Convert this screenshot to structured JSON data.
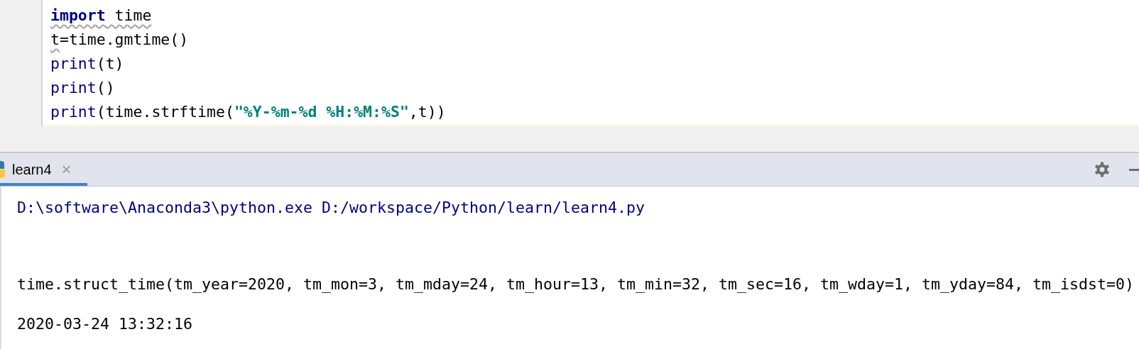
{
  "editor": {
    "lines": [
      {
        "tokens": [
          {
            "kind": "keyword",
            "text": "import",
            "warning": true
          },
          {
            "kind": "plain",
            "text": " time",
            "warning": true
          }
        ]
      },
      {
        "tokens": [
          {
            "kind": "plain",
            "text": "t",
            "warning": true
          },
          {
            "kind": "plain",
            "text": "=time.gmtime()",
            "warning": false
          }
        ]
      },
      {
        "tokens": [
          {
            "kind": "builtin",
            "text": "print",
            "warning": false
          },
          {
            "kind": "plain",
            "text": "(t)",
            "warning": false
          }
        ]
      },
      {
        "tokens": [
          {
            "kind": "builtin",
            "text": "print",
            "warning": false
          },
          {
            "kind": "plain",
            "text": "()",
            "warning": false
          }
        ]
      },
      {
        "tokens": [
          {
            "kind": "builtin",
            "text": "print",
            "warning": false
          },
          {
            "kind": "plain",
            "text": "(time.strftime(",
            "warning": false
          },
          {
            "kind": "string",
            "text": "\"%Y-%m-%d %H:%M:%S\"",
            "warning": false
          },
          {
            "kind": "plain",
            "text": ",t))",
            "warning": false
          }
        ]
      }
    ]
  },
  "run_panel": {
    "tabs": [
      {
        "label": "learn4",
        "selected": true,
        "close": "×"
      }
    ],
    "console": [
      {
        "kind": "command",
        "text": "D:\\software\\Anaconda3\\python.exe D:/workspace/Python/learn/learn4.py"
      },
      {
        "kind": "output",
        "text": "time.struct_time(tm_year=2020, tm_mon=3, tm_mday=24, tm_hour=13, tm_min=32, tm_sec=16, tm_wday=1, tm_yday=84, tm_isdst=0)"
      },
      {
        "kind": "output",
        "text": "2020-03-24 13:32:16"
      }
    ]
  }
}
